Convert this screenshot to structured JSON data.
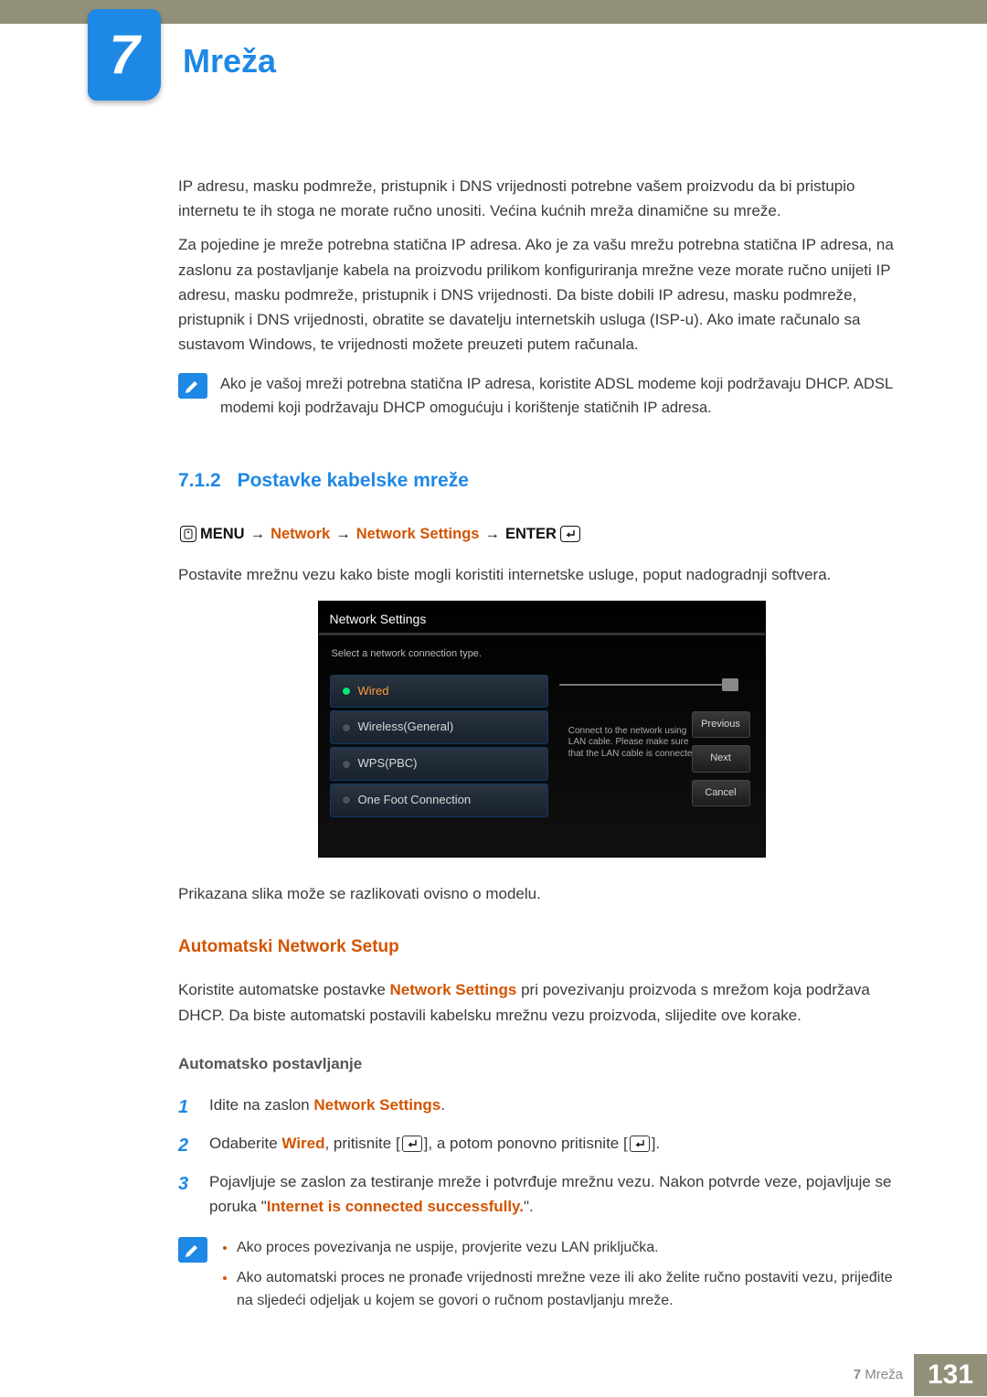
{
  "chapter": {
    "number": "7",
    "title": "Mreža"
  },
  "body": {
    "p1": "IP adresu, masku podmreže, pristupnik i DNS vrijednosti potrebne vašem proizvodu da bi pristupio internetu te ih stoga ne morate ručno unositi. Većina kućnih mreža dinamične su mreže.",
    "p2": "Za pojedine je mreže potrebna statična IP adresa. Ako je za vašu mrežu potrebna statična IP adresa, na zaslonu za postavljanje kabela na proizvodu prilikom konfiguriranja mrežne veze morate ručno unijeti IP adresu, masku podmreže, pristupnik i DNS vrijednosti. Da biste dobili IP adresu, masku podmreže, pristupnik i DNS vrijednosti, obratite se davatelju internetskih usluga (ISP-u). Ako imate računalo sa sustavom Windows, te vrijednosti možete preuzeti putem računala.",
    "note1": "Ako je vašoj mreži potrebna statična IP adresa, koristite ADSL modeme koji podržavaju DHCP. ADSL modemi koji podržavaju DHCP omogućuju i korištenje statičnih IP adresa."
  },
  "section": {
    "num": "7.1.2",
    "title": "Postavke kabelske mreže"
  },
  "menupath": {
    "menu": "MENU",
    "network": "Network",
    "settings": "Network Settings",
    "enter": "ENTER",
    "arrow": "→"
  },
  "p3": "Postavite mrežnu vezu kako biste mogli koristiti internetske usluge, poput nadogradnji softvera.",
  "dialog": {
    "title": "Network Settings",
    "subtitle": "Select a network connection type.",
    "options": {
      "wired": "Wired",
      "wireless": "Wireless(General)",
      "wps": "WPS(PBC)",
      "onefoot": "One Foot Connection"
    },
    "hint": "Connect to the network using LAN cable. Please make sure that the LAN cable is connected.",
    "buttons": {
      "prev": "Previous",
      "next": "Next",
      "cancel": "Cancel"
    }
  },
  "p4": "Prikazana slika može se razlikovati ovisno o modelu.",
  "auto_heading": "Automatski Network Setup",
  "auto": {
    "t1": "Koristite automatske postavke ",
    "t1b": "Network Settings",
    "t2": " pri povezivanju proizvoda s mrežom koja podržava DHCP. Da biste automatski postavili kabelsku mrežnu vezu proizvoda, slijedite ove korake."
  },
  "steps_title": "Automatsko postavljanje",
  "steps": {
    "s1a": "Idite na zaslon ",
    "s1b": "Network Settings",
    "s1c": ".",
    "s2a": "Odaberite ",
    "s2b": "Wired",
    "s2c": ", pritisnite [",
    "s2d": "], a potom ponovno pritisnite [",
    "s2e": "].",
    "s3a": "Pojavljuje se zaslon za testiranje mreže i potvrđuje mrežnu vezu. Nakon potvrde veze, pojavljuje se poruka \"",
    "s3b": "Internet is connected successfully.",
    "s3c": "\"."
  },
  "note2": {
    "li1": "Ako proces povezivanja ne uspije, provjerite vezu LAN priključka.",
    "li2": "Ako automatski proces ne pronađe vrijednosti mrežne veze ili ako želite ručno postaviti vezu, prijeđite na sljedeći odjeljak u kojem se govori o ručnom postavljanju mreže."
  },
  "footer": {
    "crumb_num": "7",
    "crumb_title": "Mreža",
    "page": "131"
  }
}
